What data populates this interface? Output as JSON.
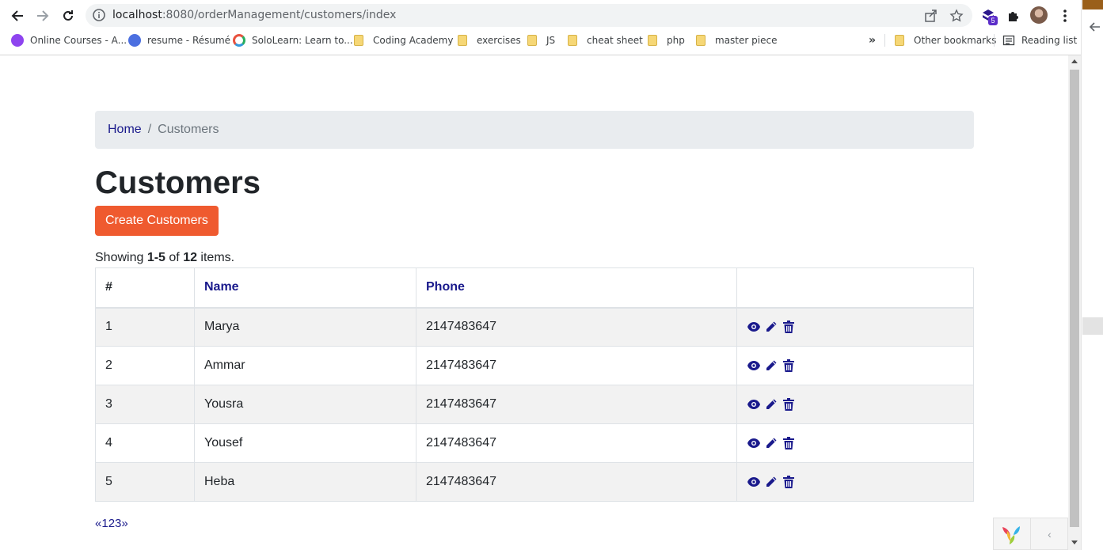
{
  "browser": {
    "url_host": "localhost",
    "url_rest": ":8080/orderManagement/customers/index",
    "extension_badge": "5",
    "bookmarks": [
      {
        "label": "Online Courses - A...",
        "icon": "graduation-icon"
      },
      {
        "label": "resume - Résumé",
        "icon": "resume-icon"
      },
      {
        "label": "SoloLearn: Learn to...",
        "icon": "sololearn-icon"
      },
      {
        "label": "Coding Academy",
        "icon": "folder-icon"
      },
      {
        "label": "exercises",
        "icon": "folder-icon"
      },
      {
        "label": "JS",
        "icon": "folder-icon"
      },
      {
        "label": "cheat sheet",
        "icon": "folder-icon"
      },
      {
        "label": "php",
        "icon": "folder-icon"
      },
      {
        "label": "master piece",
        "icon": "folder-icon"
      }
    ],
    "overflow_label": "»",
    "other_bookmarks": "Other bookmarks",
    "reading_list": "Reading list"
  },
  "breadcrumb": {
    "home": "Home",
    "separator": "/",
    "current": "Customers"
  },
  "page": {
    "title": "Customers",
    "create_button": "Create Customers"
  },
  "summary": {
    "prefix": "Showing ",
    "range": "1-5",
    "middle": " of ",
    "total": "12",
    "suffix": " items."
  },
  "table": {
    "headers": {
      "num": "#",
      "name": "Name",
      "phone": "Phone",
      "actions": ""
    },
    "rows": [
      {
        "num": "1",
        "name": "Marya",
        "phone": "2147483647"
      },
      {
        "num": "2",
        "name": "Ammar",
        "phone": "2147483647"
      },
      {
        "num": "3",
        "name": "Yousra",
        "phone": "2147483647"
      },
      {
        "num": "4",
        "name": "Yousef",
        "phone": "2147483647"
      },
      {
        "num": "5",
        "name": "Heba",
        "phone": "2147483647"
      }
    ]
  },
  "pagination": {
    "prev": "«",
    "pages": [
      "1",
      "2",
      "3"
    ],
    "next": "»"
  },
  "debug_toolbar": {
    "toggle": "‹"
  },
  "colors": {
    "accent": "#ef5a2f",
    "link": "#1a1a8c",
    "breadcrumb_bg": "#e9ecef",
    "stripe": "#f2f2f2"
  }
}
